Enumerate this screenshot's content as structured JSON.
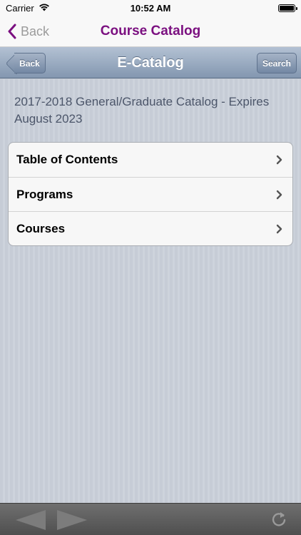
{
  "status_bar": {
    "carrier": "Carrier",
    "time": "10:52 AM"
  },
  "nav_bar": {
    "back_label": "Back",
    "title": "Course Catalog"
  },
  "toolbar": {
    "back_label": "Back",
    "title": "E-Catalog",
    "search_label": "Search"
  },
  "main": {
    "heading": "2017-2018 General/Graduate Catalog - Expires August 2023",
    "items": [
      {
        "label": "Table of Contents"
      },
      {
        "label": "Programs"
      },
      {
        "label": "Courses"
      }
    ]
  },
  "colors": {
    "accent": "#7b1080",
    "toolbar": "#8397b0",
    "bottom_bar": "#5a5a5a"
  },
  "icons": {
    "wifi": "wifi-icon",
    "battery": "battery-icon",
    "back": "chevron-left-icon",
    "row": "chevron-right-icon",
    "prev": "prev-arrow-icon",
    "next": "next-arrow-icon",
    "refresh": "refresh-icon"
  }
}
